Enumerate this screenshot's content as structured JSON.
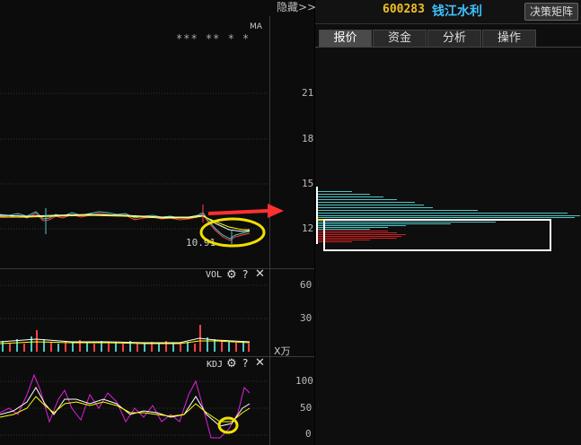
{
  "header": {
    "hide_label": "隐藏>>",
    "stock_code": "600283",
    "stock_name": "钱江水利",
    "decision_button": "决策矩阵"
  },
  "tabs": [
    {
      "label": "报价",
      "active": true
    },
    {
      "label": "资金",
      "active": false
    },
    {
      "label": "分析",
      "active": false
    },
    {
      "label": "操作",
      "active": false
    }
  ],
  "main_panel": {
    "ma_label": "MA",
    "masked_text": "*** ** * *",
    "price_ticks": [
      "21",
      "18",
      "15",
      "12"
    ],
    "low_price_label": "10.91"
  },
  "vol_panel": {
    "label": "VOL",
    "ticks": [
      "60",
      "30"
    ],
    "unit": "X万"
  },
  "kdj_panel": {
    "label": "KDJ",
    "ticks": [
      "100",
      "50",
      "0"
    ]
  },
  "icons": {
    "settings": "gear-icon",
    "help": "question-icon",
    "close": "close-icon"
  },
  "colors": {
    "code": "#f0c020",
    "name": "#40c0ff",
    "annotation_ellipse": "#f0e000",
    "arrow": "#ff3030",
    "chip_upper": "#4ec6c6",
    "chip_lower": "#d02020",
    "kdj_k": "#ffffff",
    "kdj_d": "#ffff00",
    "kdj_j": "#e020e0"
  }
}
